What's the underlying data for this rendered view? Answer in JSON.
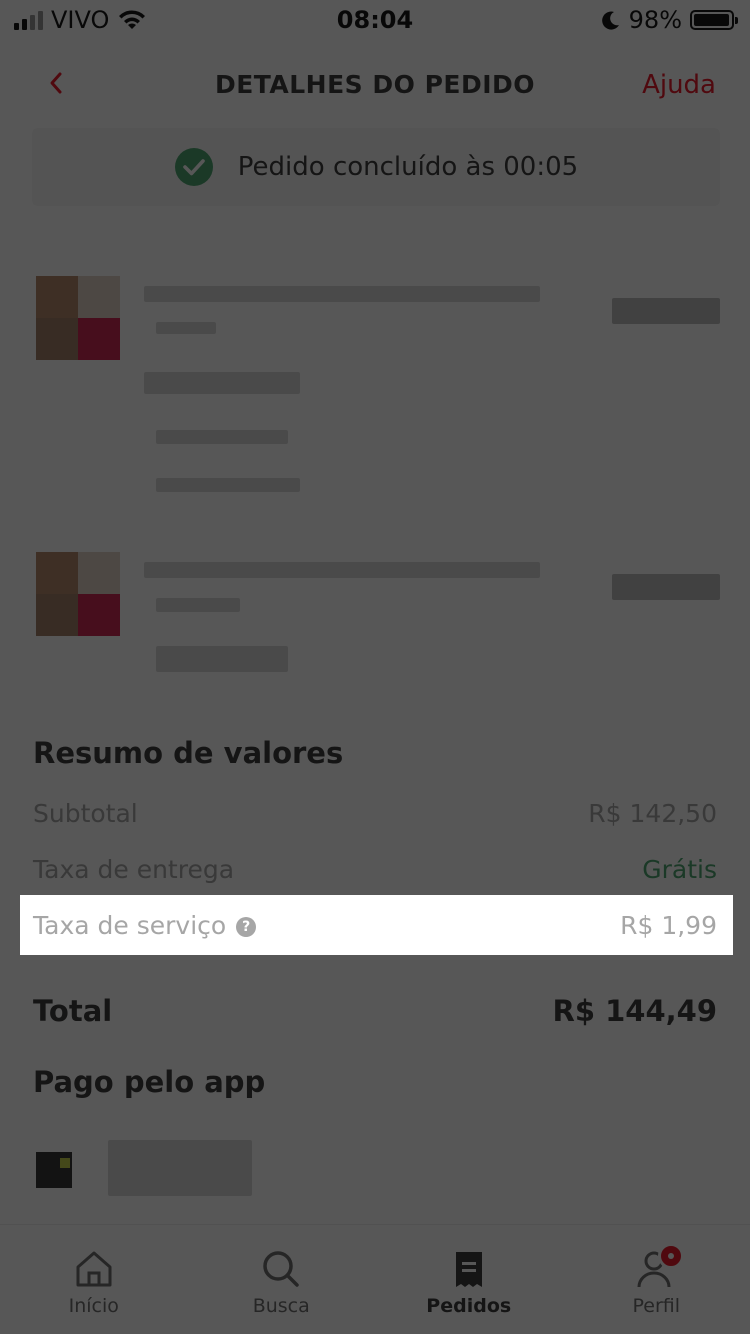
{
  "status_bar": {
    "carrier": "VIVO",
    "time": "08:04",
    "battery": "98%"
  },
  "header": {
    "title": "DETALHES DO PEDIDO",
    "help_label": "Ajuda"
  },
  "order_status": {
    "text": "Pedido concluído às 00:05"
  },
  "summary": {
    "title": "Resumo de valores",
    "subtotal_label": "Subtotal",
    "subtotal_value": "R$ 142,50",
    "delivery_label": "Taxa de entrega",
    "delivery_value": "Grátis",
    "service_label": "Taxa de serviço",
    "service_help": "?",
    "service_value": "R$ 1,99",
    "total_label": "Total",
    "total_value": "R$ 144,49"
  },
  "payment": {
    "title": "Pago pelo app"
  },
  "bottom_nav": {
    "items": [
      {
        "label": "Início",
        "icon": "home-icon"
      },
      {
        "label": "Busca",
        "icon": "search-icon"
      },
      {
        "label": "Pedidos",
        "icon": "receipt-icon"
      },
      {
        "label": "Perfil",
        "icon": "profile-icon"
      }
    ],
    "active": "Pedidos"
  },
  "colors": {
    "brand_red": "#ea1d2c",
    "success_green": "#50a773",
    "text_dark": "#3f3e3e",
    "text_muted": "#a6a6a6",
    "overlay": "#000000"
  }
}
